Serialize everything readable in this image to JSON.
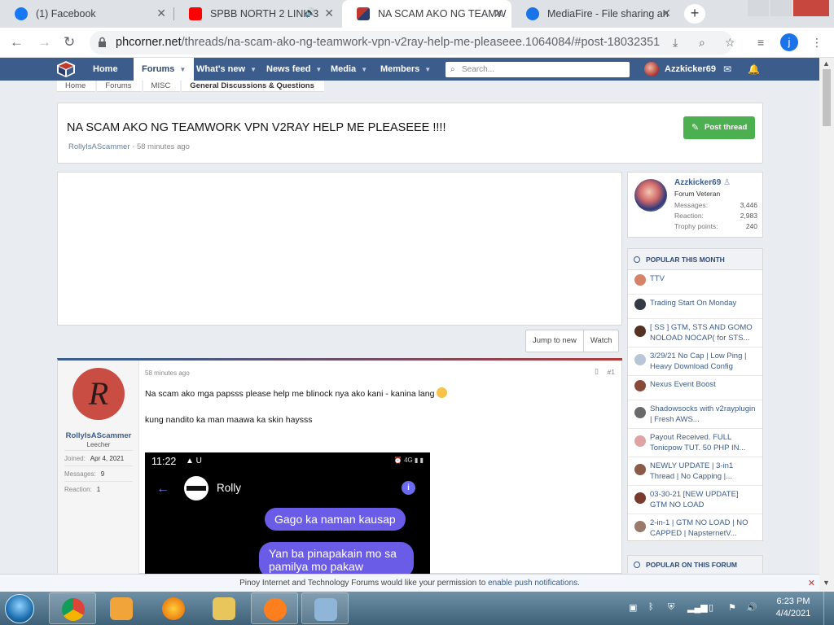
{
  "browser": {
    "tabs": [
      {
        "title": "(1) Facebook",
        "favicon": "facebook-icon"
      },
      {
        "title": "SPBB NORTH 2 LINK 3",
        "favicon": "youtube-icon"
      },
      {
        "title": "NA SCAM AKO NG TEAMW",
        "favicon": "phcorner-icon"
      },
      {
        "title": "MediaFire - File sharing an",
        "favicon": "mediafire-icon"
      }
    ],
    "url_host": "phcorner.net",
    "url_path": "/threads/na-scam-ako-ng-teamwork-vpn-v2ray-help-me-pleaseee.1064084/#post-18032351",
    "profile_initial": "j"
  },
  "site": {
    "nav": [
      "Home",
      "Forums",
      "What's new",
      "News feed",
      "Media",
      "Members"
    ],
    "search_placeholder": "Search...",
    "username": "Azzkicker69"
  },
  "breadcrumbs": [
    "Home",
    "Forums",
    "MISC",
    "General Discussions & Questions"
  ],
  "thread": {
    "title": "NA SCAM AKO NG TEAMWORK VPN V2RAY HELP ME PLEASEEE !!!!",
    "author": "RollyIsAScammer",
    "time": "58 minutes ago",
    "post_button": "Post thread",
    "jump_label": "Jump to new",
    "watch_label": "Watch"
  },
  "post": {
    "author": "RollyIsAScammer",
    "avatar_letter": "R",
    "rank": "Leecher",
    "joined_label": "Joined:",
    "joined": "Apr 4, 2021",
    "messages_label": "Messages:",
    "messages": "9",
    "reaction_label": "Reaction:",
    "reaction": "1",
    "time": "58 minutes ago",
    "number": "#1",
    "line1": "Na scam ako mga papsss please help me blinock nya ako kani - kanina lang",
    "line2": "kung nandito ka man maawa ka skin haysss",
    "screenshot": {
      "clock": "11:22",
      "status_left": "▲ U",
      "status_right": "⏰ 4G ▮ ▮",
      "contact": "Rolly",
      "bubble1": "Gago ka  naman kausap",
      "bubble2": "Yan ba pinapakain mo sa pamilya mo pakaw"
    }
  },
  "sidebar": {
    "user": {
      "name": "Azzkicker69",
      "title": "Forum Veteran",
      "stats": [
        {
          "label": "Messages:",
          "value": "3,446"
        },
        {
          "label": "Reaction:",
          "value": "2,983"
        },
        {
          "label": "Trophy points:",
          "value": "240"
        }
      ]
    },
    "popular_month_heading": "POPULAR THIS MONTH",
    "popular": [
      {
        "title": "TTV",
        "color": "#d9826a"
      },
      {
        "title": "Trading Start On Monday",
        "color": "#333a44"
      },
      {
        "title": "[ SS ] GTM, STS AND GOMO NOLOAD NOCAP( for STS...",
        "color": "#553322"
      },
      {
        "title": "3/29/21 No Cap | Low Ping | Heavy Download Config",
        "color": "#b9c6d8"
      },
      {
        "title": "Nexus Event Boost",
        "color": "#8a4a3a"
      },
      {
        "title": "Shadowsocks with v2rayplugin | Fresh AWS...",
        "color": "#6a6a6a"
      },
      {
        "title": "Payout Received. FULL Tonicpow TUT. 50 PHP IN...",
        "color": "#e0a3a3"
      },
      {
        "title": "NEWLY UPDATE | 3-in1 Thread | No Capping |...",
        "color": "#8b5b4a"
      },
      {
        "title": "03-30-21 [NEW UPDATE] GTM NO LOAD",
        "color": "#7a3b2e"
      },
      {
        "title": "2-in-1 | GTM NO LOAD | NO CAPPED | NapsternetV...",
        "color": "#9a7a6a"
      }
    ],
    "popular_forum_heading": "POPULAR ON THIS FORUM"
  },
  "notice": {
    "text": "Pinoy Internet and Technology Forums would like your permission to ",
    "link": "enable push notifications."
  },
  "taskbar": {
    "time": "6:23 PM",
    "date": "4/4/2021"
  },
  "colors": {
    "nav_bg": "#3c5c8b",
    "post_button": "#4caf50",
    "link": "#3c5c8b"
  }
}
